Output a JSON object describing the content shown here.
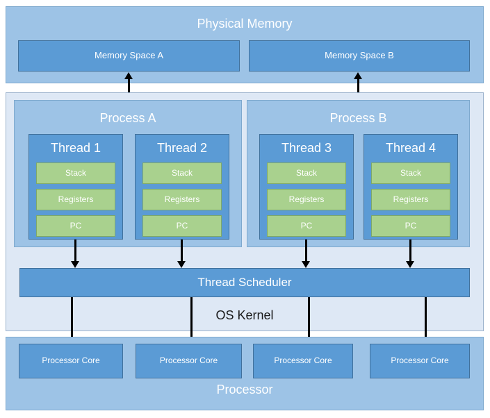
{
  "diagram": {
    "title_physical_memory": "Physical Memory",
    "title_os_kernel": "OS Kernel",
    "title_processor": "Processor",
    "memory_spaces": [
      {
        "label": "Memory Space A"
      },
      {
        "label": "Memory Space B"
      }
    ],
    "processes": [
      {
        "label": "Process A",
        "threads": [
          {
            "label": "Thread 1",
            "slots": [
              "Stack",
              "Registers",
              "PC"
            ]
          },
          {
            "label": "Thread 2",
            "slots": [
              "Stack",
              "Registers",
              "PC"
            ]
          }
        ]
      },
      {
        "label": "Process B",
        "threads": [
          {
            "label": "Thread 3",
            "slots": [
              "Stack",
              "Registers",
              "PC"
            ]
          },
          {
            "label": "Thread 4",
            "slots": [
              "Stack",
              "Registers",
              "PC"
            ]
          }
        ]
      }
    ],
    "scheduler": {
      "label": "Thread Scheduler"
    },
    "cores": [
      {
        "label": "Processor Core"
      },
      {
        "label": "Processor Core"
      },
      {
        "label": "Processor Core"
      },
      {
        "label": "Processor Core"
      }
    ],
    "colors": {
      "shell_light_blue": "#9DC3E6",
      "shell_pale_blue": "#DEE8F5",
      "panel_mid_blue": "#5B9BD5",
      "panel_green": "#A9D18E",
      "border_blue": "#41719C",
      "arrow_black": "#000000",
      "text_white": "#FFFFFF",
      "text_dark": "#1A1A1A",
      "page_background": "#FFFFFF"
    }
  }
}
